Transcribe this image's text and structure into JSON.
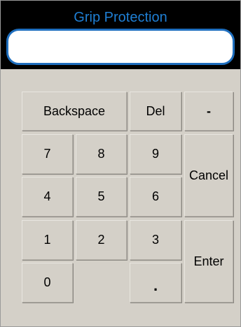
{
  "window": {
    "title": "Grip Protection"
  },
  "display": {
    "value": ""
  },
  "keys": {
    "backspace": "Backspace",
    "del": "Del",
    "minus": "-",
    "seven": "7",
    "eight": "8",
    "nine": "9",
    "cancel": "Cancel",
    "four": "4",
    "five": "5",
    "six": "6",
    "one": "1",
    "two": "2",
    "three": "3",
    "enter": "Enter",
    "zero": "0",
    "dot": "."
  },
  "colors": {
    "title": "#1f7fd4",
    "header_background": "#000000",
    "keypad_background": "#d4d0c8",
    "display_border": "#1f6fbf"
  }
}
